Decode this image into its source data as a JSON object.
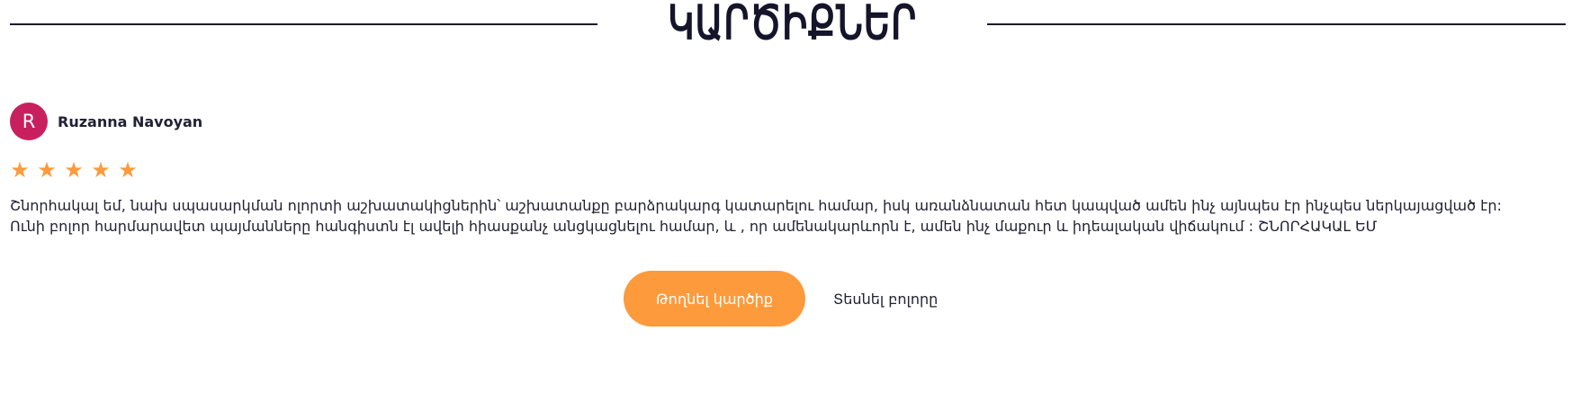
{
  "section": {
    "title": "ԿԱՐԾԻՔՆԵՐ"
  },
  "review": {
    "avatar_letter": "R",
    "avatar_color": "#c8205e",
    "author": "Ruzanna Navoyan",
    "rating": 5,
    "star_color": "#fd9a3c",
    "text_lines": [
      "Շնորհակալ եմ, նախ սպասարկման ոլորտի աշխատակիցներին՝ աշխատանքը բարձրակարգ կատարելու համար, իսկ առանձնատան հետ կապված ամեն ինչ այնպես էր ինչպես ներկայացված էր:",
      "Ունի բոլոր հարմարավետ պայմանները հանգիստն էլ ավելի հիասքանչ անցկացնելու համար, և , որ ամենակարևորն է, ամեն ինչ մաքուր և իդեալական վիճակում : ՇՆՈՐՀԱԿԱԼ ԵՄ"
    ]
  },
  "actions": {
    "leave_review_label": "Թողնել կարծիք",
    "view_all_label": "Տեսնել բոլորը",
    "accent_color": "#fd9a3c"
  }
}
